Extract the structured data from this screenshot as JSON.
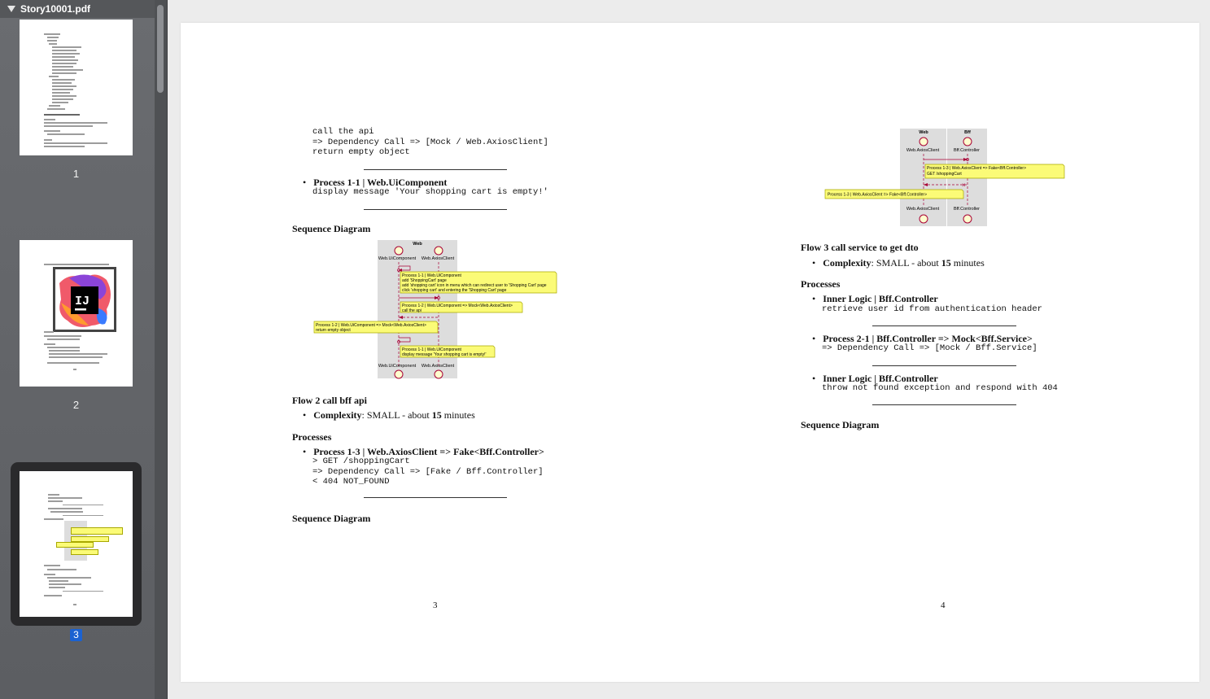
{
  "sidebar": {
    "file_name": "Story10001.pdf",
    "thumbnails": [
      {
        "page_label": "1"
      },
      {
        "page_label": "2"
      },
      {
        "page_label": "3",
        "selected": true
      }
    ]
  },
  "colors": {
    "note_fill": "#fbfb77",
    "lifeline_box": "#dddddd",
    "arrow": "#a80036",
    "selection": "#1b62d1"
  },
  "page3": {
    "code1": [
      "call the api",
      "=> Dependency Call => [Mock / Web.AxiosClient]",
      "return empty object"
    ],
    "item1": {
      "title": "Process 1-1 | Web.UiComponent",
      "code": "display message 'Your shopping cart is empty!'"
    },
    "seq_heading": "Sequence Diagram",
    "diagram1": {
      "group": "Web",
      "participants": [
        "Web.UiComponent",
        "Web.AxiosClient"
      ],
      "notes": [
        [
          "Process 1-1 | Web.UiComponent",
          "add 'ShoppingCart' page",
          "add 'shopping cart' icon in menu which can redirect user to 'Shopping Cart' page",
          "click 'shopping cart' and entering the 'Shopping Cart' page"
        ],
        [
          "Process 1-2 | Web.UiComponent => Mock<Web.AxiosClient>",
          "call the api"
        ],
        [
          "Process 1-2 | Web.UiComponent => Mock<Web.AxiosClient>",
          "return empty object"
        ],
        [
          "Process 1-1 | Web.UiComponent",
          "display message 'Your shopping cart is empty!'"
        ]
      ]
    },
    "flow2": {
      "heading": "Flow 2 call bff api",
      "complexity_label": "Complexity",
      "complexity_value": ": SMALL - about ",
      "minutes_num": "15",
      "minutes_word": " minutes"
    },
    "processes_heading": "Processes",
    "item2": {
      "title": "Process 1-3 | Web.AxiosClient => Fake<Bff.Controller>",
      "code": [
        "> GET /shoppingCart",
        "=> Dependency Call => [Fake / Bff.Controller]",
        "< 404 NOT_FOUND"
      ]
    },
    "seq_heading2": "Sequence Diagram",
    "page_number": "3"
  },
  "page4": {
    "diagram2": {
      "groups": [
        "Web",
        "Bff"
      ],
      "participants": [
        "Web.AxiosClient",
        "Bff.Controller"
      ],
      "notes": [
        [
          "Process 1-3 | Web.AxiosClient => Fake<Bff.Controller>",
          "GET /shoppingCart"
        ],
        [
          "Process 1-3 | Web.AxiosClient => Fake<Bff.Controller>"
        ]
      ]
    },
    "flow3": {
      "heading": "Flow 3 call service to get dto",
      "complexity_label": "Complexity",
      "complexity_value": ": SMALL - about ",
      "minutes_num": "15",
      "minutes_word": " minutes"
    },
    "processes_heading": "Processes",
    "items": [
      {
        "title": "Inner Logic | Bff.Controller",
        "code": "retrieve user id from authentication header"
      },
      {
        "title": "Process 2-1 | Bff.Controller => Mock<Bff.Service>",
        "code": "=> Dependency Call => [Mock / Bff.Service]"
      },
      {
        "title": "Inner Logic | Bff.Controller",
        "code": "throw not found exception and respond with 404"
      }
    ],
    "seq_heading": "Sequence Diagram",
    "page_number": "4"
  }
}
